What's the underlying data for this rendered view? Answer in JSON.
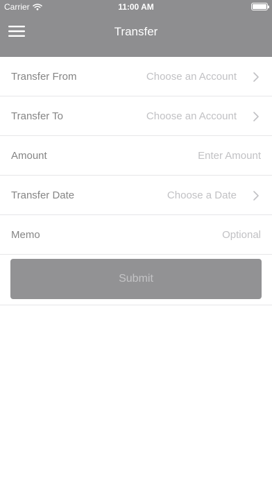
{
  "status_bar": {
    "carrier": "Carrier",
    "time": "11:00 AM",
    "wifi_icon": "wifi-icon",
    "battery_icon": "battery-icon"
  },
  "nav": {
    "title": "Transfer",
    "menu_icon": "hamburger-menu-icon"
  },
  "form": {
    "rows": [
      {
        "label": "Transfer From",
        "placeholder": "Choose an Account",
        "chevron": true
      },
      {
        "label": "Transfer To",
        "placeholder": "Choose an Account",
        "chevron": true
      },
      {
        "label": "Amount",
        "placeholder": "Enter Amount",
        "chevron": false
      },
      {
        "label": "Transfer Date",
        "placeholder": "Choose a Date",
        "chevron": true
      },
      {
        "label": "Memo",
        "placeholder": "Optional",
        "chevron": false
      }
    ],
    "submit_label": "Submit"
  },
  "colors": {
    "header_bg": "#8e8e90",
    "submit_bg": "#929294",
    "label_text": "#858585",
    "placeholder_text": "#c1c1c4"
  }
}
